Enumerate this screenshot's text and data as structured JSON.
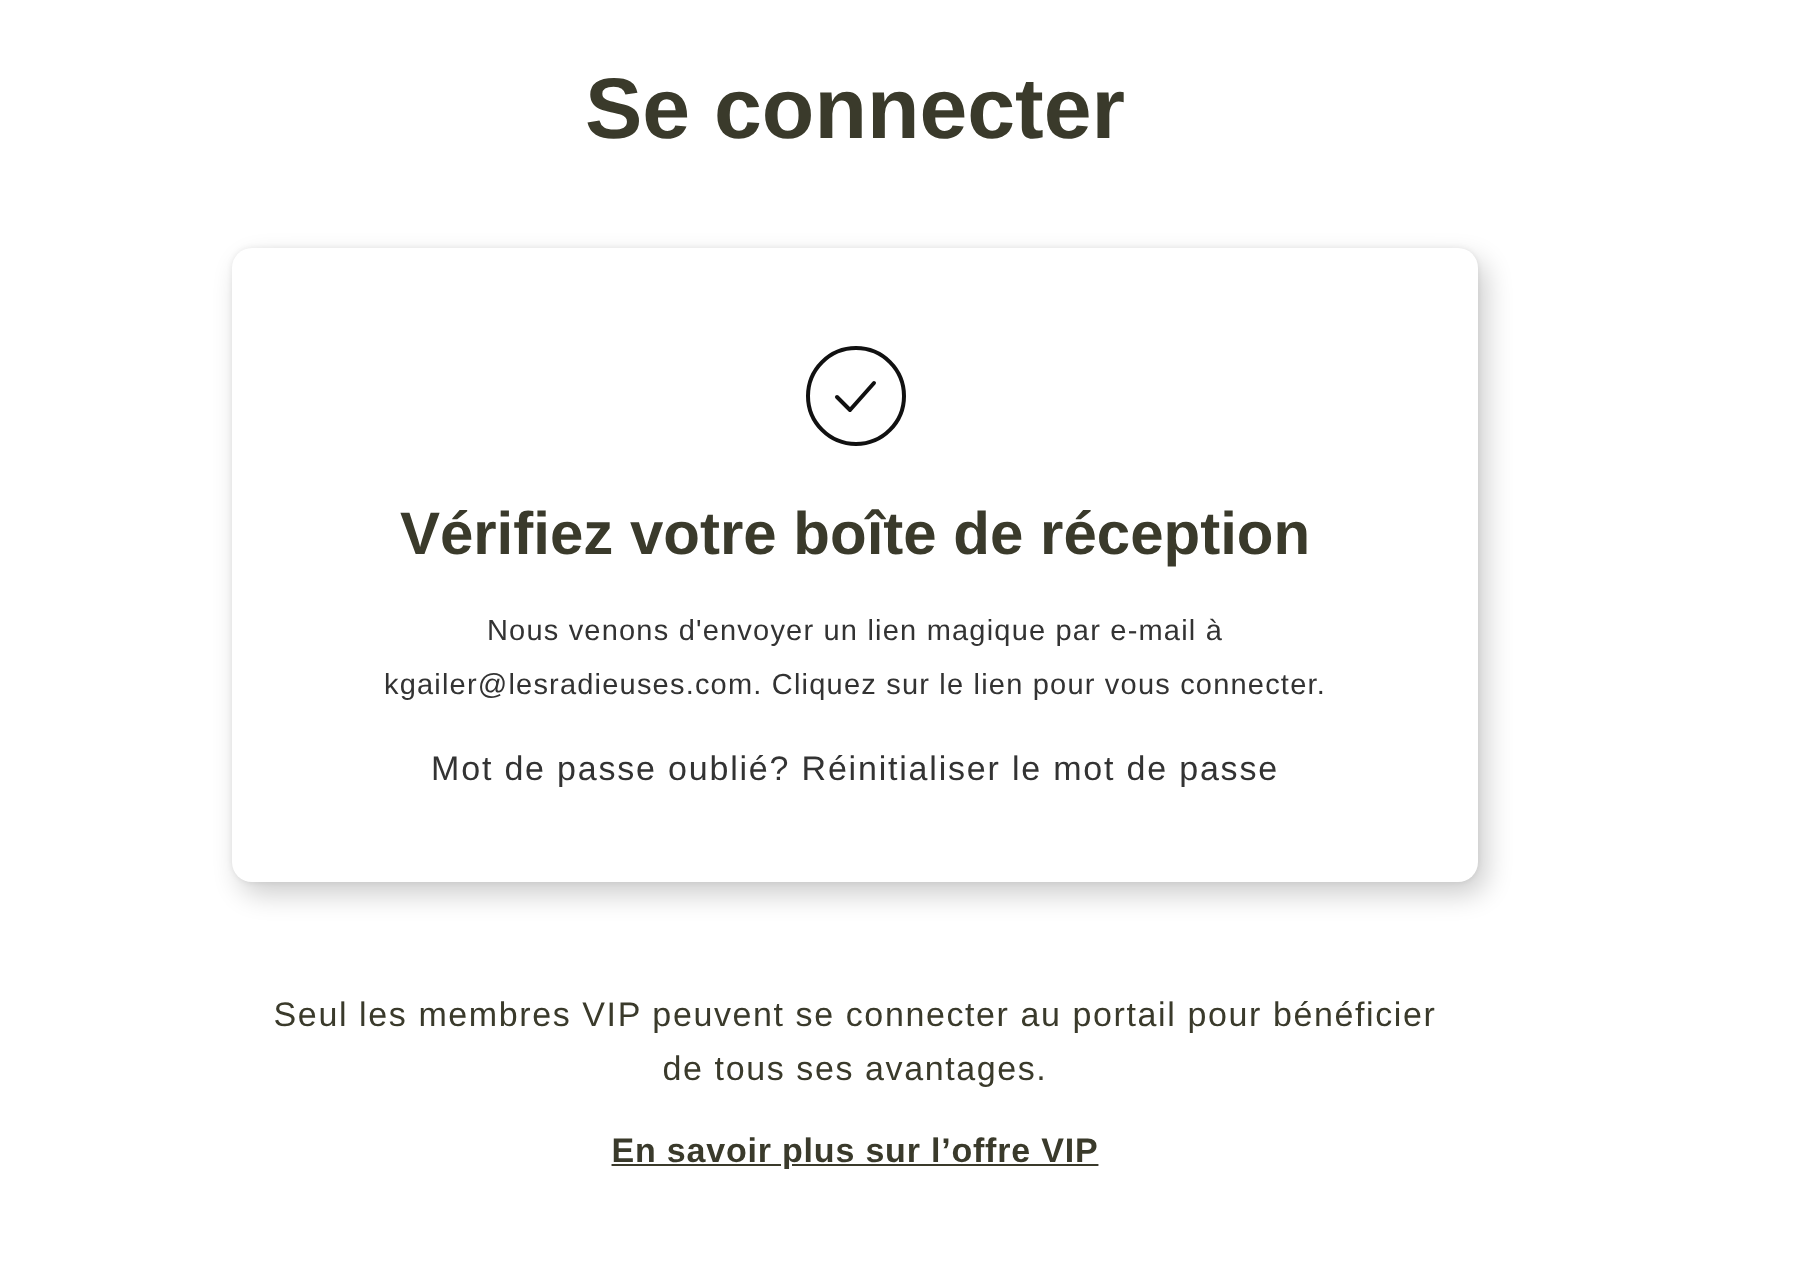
{
  "page": {
    "title": "Se connecter"
  },
  "card": {
    "heading": "Vérifiez votre boîte de réception",
    "message": "Nous venons d'envoyer un lien magique par e-mail à kgailer@lesradieuses.com. Cliquez sur le lien pour vous connecter.",
    "forgot_password": {
      "question": "Mot de passe oublié?",
      "link": "Réinitialiser le mot de passe"
    }
  },
  "footer": {
    "text": "Seul les membres VIP peuvent se connecter au portail pour bénéficier de tous ses avantages.",
    "link": "En savoir plus sur l’offre VIP"
  }
}
